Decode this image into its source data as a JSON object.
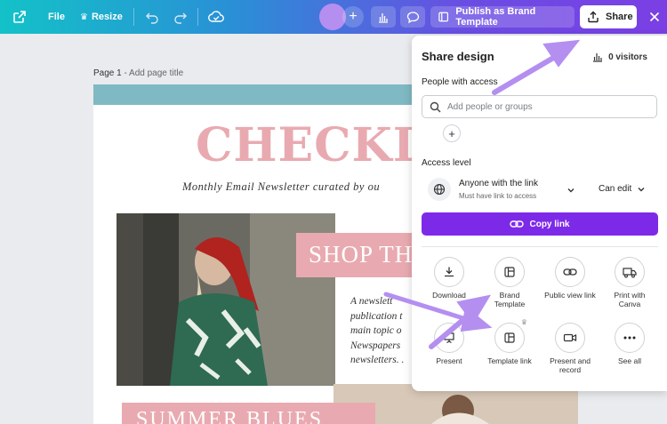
{
  "toolbar": {
    "file_label": "File",
    "resize_label": "Resize",
    "publish_label": "Publish as Brand Template",
    "share_label": "Share",
    "icons": [
      "external-link-icon",
      "crown-icon",
      "undo-icon",
      "redo-icon",
      "cloud-save-icon",
      "plus-icon",
      "chart-icon",
      "comment-icon",
      "template-icon",
      "share-upload-icon",
      "close-icon"
    ]
  },
  "canvas": {
    "page_label": "Page 1",
    "page_separator": " - ",
    "page_title_placeholder": "Add page title",
    "design": {
      "title": "CHECKLI",
      "subtitle": "Monthly Email Newsletter curated by ou",
      "shop_text": "SHOP TH",
      "body_lines": "A newslett\npublication t\nmain topic o\nNewspapers\nnewsletters. .",
      "summer_text": "SUMMER BLUES",
      "band_color": "#7fb9c3",
      "accent_color": "#e8aab0"
    }
  },
  "share_panel": {
    "title": "Share design",
    "visitors": "0 visitors",
    "people_label": "People with access",
    "search_placeholder": "Add people or groups",
    "access_level_label": "Access level",
    "access_main": "Anyone with the link",
    "access_sub": "Must have link to access",
    "permission": "Can edit",
    "copy_link_label": "Copy link",
    "options": [
      {
        "label": "Download",
        "icon": "download-icon"
      },
      {
        "label": "Brand\nTemplate",
        "icon": "brand-template-icon"
      },
      {
        "label": "Public view link",
        "icon": "link-icon"
      },
      {
        "label": "Print with\nCanva",
        "icon": "truck-icon"
      },
      {
        "label": "Present",
        "icon": "present-icon"
      },
      {
        "label": "Template link",
        "icon": "template-link-icon"
      },
      {
        "label": "Present and\nrecord",
        "icon": "record-icon"
      },
      {
        "label": "See all",
        "icon": "more-icon"
      }
    ]
  },
  "colors": {
    "brand_purple": "#7d2ae8",
    "arrow_purple": "#b48ff0"
  }
}
